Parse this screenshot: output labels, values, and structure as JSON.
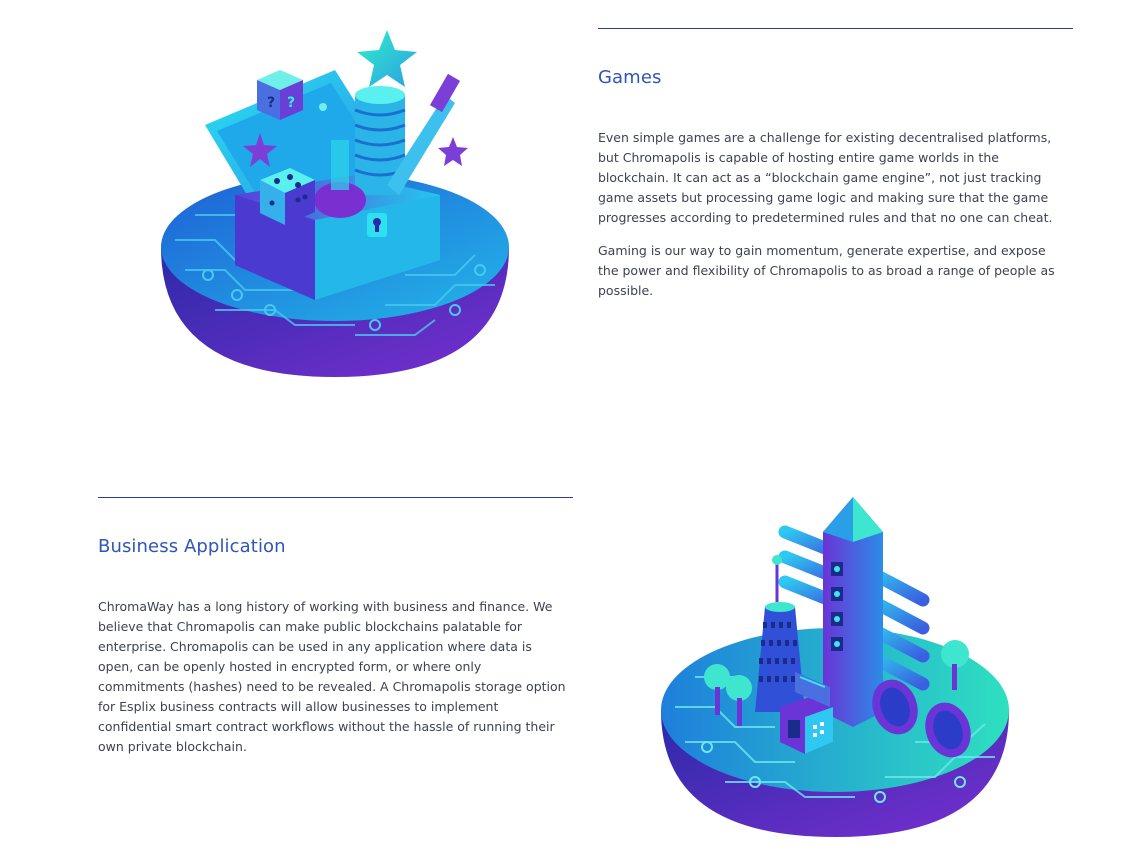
{
  "games": {
    "title": "Games",
    "paragraph1": "Even simple games are a challenge for existing decentralised platforms, but Chromapolis is capable of hosting entire game worlds in the blockchain. It can act as a “blockchain game engine”, not just tracking game assets but processing game logic and making sure that the game progresses according to predetermined rules and that no one can cheat.",
    "paragraph2": "Gaming is our way to gain momentum, generate expertise, and expose the power and flexibility of Chromapolis to as broad a range of people as possible."
  },
  "business": {
    "title": "Business Application",
    "paragraph1": "ChromaWay has a long history of working with business and finance. We believe that Chromapolis can make public blockchains palatable for enterprise. Chromapolis can be used in any application where data is open, can be openly hosted in encrypted form, or where only commitments (hashes) need to be revealed. A Chromapolis storage option for Esplix business contracts will allow businesses to implement confidential smart contract workflows without the hassle of running their own private blockchain."
  },
  "colors": {
    "heading": "#2e56b8",
    "rule": "#2c3e8c",
    "text": "#3d4250",
    "accent_cyan": "#22d3e6",
    "accent_purple": "#6b2fc9",
    "accent_blue": "#2463d6"
  },
  "icons": {
    "games_illustration": "treasure-chest-island-illustration",
    "business_illustration": "city-tower-island-illustration"
  }
}
